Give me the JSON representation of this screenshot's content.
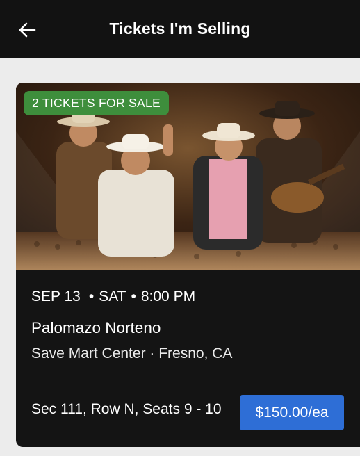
{
  "header": {
    "title": "Tickets I'm Selling",
    "back_icon": "arrow-left-icon"
  },
  "listing": {
    "badge": "2 TICKETS FOR SALE",
    "image": "band-photo",
    "date": "SEP 13",
    "day": "SAT",
    "time": "8:00 PM",
    "separator": "•",
    "event_name": "Palomazo Norteno",
    "venue": "Save Mart Center · Fresno, CA",
    "seats": "Sec 111, Row N, Seats 9 - 10",
    "price_label": "$150.00/ea"
  },
  "colors": {
    "header_bg": "#121212",
    "badge_bg": "#3e8e3c",
    "price_button_bg": "#2e6ed6",
    "card_bg": "#141414"
  }
}
